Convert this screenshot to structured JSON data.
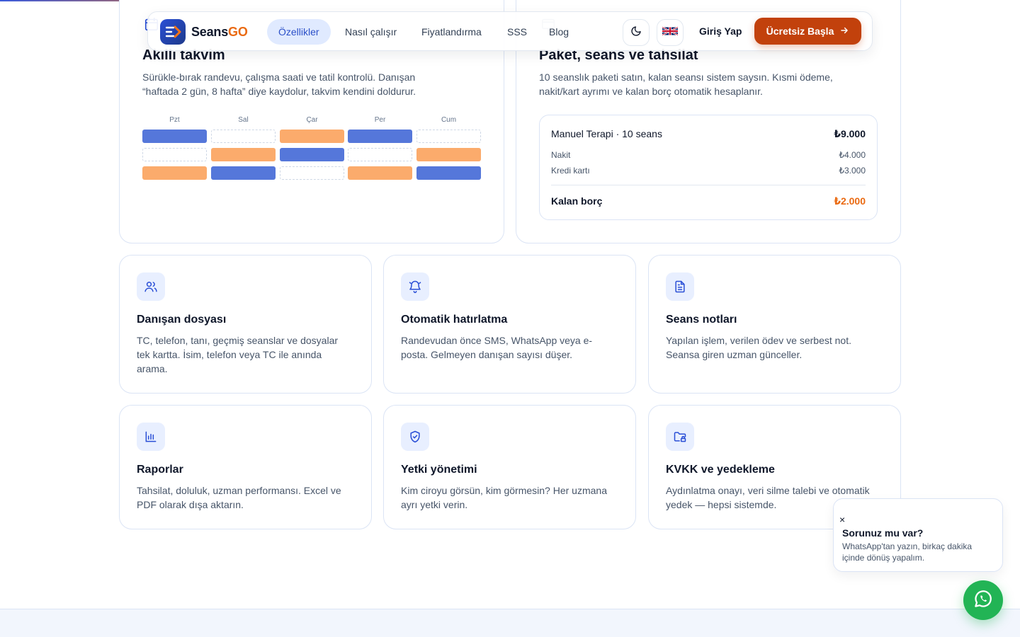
{
  "colors": {
    "brand_blue": "#2a4fd6",
    "brand_orange": "#ea6a12",
    "cta_bg": "#c2410c",
    "slot_blue": "#5577da",
    "slot_orange": "#fbab6c",
    "whatsapp_green": "#22b455",
    "accent_due": "#ea6a12"
  },
  "nav": {
    "logo_text_main": "Seans",
    "logo_text_accent": "GO",
    "links": [
      "Özellikler",
      "Nasıl çalışır",
      "Fiyatlandırma",
      "SSS",
      "Blog"
    ],
    "active_link": "Özellikler",
    "theme_toggle_icon": "moon-icon",
    "language_icon": "uk-flag-icon",
    "login_label": "Giriş Yap",
    "cta_label": "Ücretsiz Başla",
    "cta_icon": "arrow-right-icon"
  },
  "calendar_card": {
    "icon": "calendar-icon",
    "title": "Akıllı takvim",
    "description": "Sürükle-bırak randevu, çalışma saati ve tatil kontrolü. Danışan “haftada 2 gün, 8 hafta” diye kaydolur, takvim kendini doldurur.",
    "days": [
      "Pzt",
      "Sal",
      "Çar",
      "Per",
      "Cum"
    ],
    "slots": [
      [
        "blue",
        "empty",
        "orange",
        "blue",
        "empty"
      ],
      [
        "empty",
        "orange",
        "blue",
        "empty",
        "orange"
      ],
      [
        "orange",
        "blue",
        "empty",
        "orange",
        "blue"
      ]
    ]
  },
  "payment_card": {
    "icon": "package-icon",
    "title": "Paket, seans ve tahsilat",
    "description": "10 seanslık paketi satın, kalan seansı sistem saysın. Kısmi ödeme, nakit/kart ayrımı ve kalan borç otomatik hesaplanır.",
    "package_name": "Manuel Terapi · 10 seans",
    "package_total": "₺9.000",
    "cash_label": "Nakit",
    "cash_value": "₺4.000",
    "card_label": "Kredi kartı",
    "card_value": "₺3.000",
    "due_label": "Kalan borç",
    "due_value": "₺2.000"
  },
  "features": [
    {
      "icon": "users-icon",
      "title": "Danışan dosyası",
      "description": "TC, telefon, tanı, geçmiş seanslar ve dosyalar tek kartta. İsim, telefon veya TC ile anında arama."
    },
    {
      "icon": "bell-ring-icon",
      "title": "Otomatik hatırlatma",
      "description": "Randevudan önce SMS, WhatsApp veya e-posta. Gelmeyen danışan sayısı düşer."
    },
    {
      "icon": "document-icon",
      "title": "Seans notları",
      "description": "Yapılan işlem, verilen ödev ve serbest not. Seansa giren uzman günceller."
    },
    {
      "icon": "bar-chart-icon",
      "title": "Raporlar",
      "description": "Tahsilat, doluluk, uzman performansı. Excel ve PDF olarak dışa aktarın."
    },
    {
      "icon": "shield-check-icon",
      "title": "Yetki yönetimi",
      "description": "Kim ciroyu görsün, kim görmesin? Her uzmana ayrı yetki verin."
    },
    {
      "icon": "folder-lock-icon",
      "title": "KVKK ve yedekleme",
      "description": "Aydınlatma onayı, veri silme talebi ve otomatik yedek — hepsi sistemde."
    }
  ],
  "whatsapp": {
    "close_symbol": "×",
    "title": "Sorunuz mu var?",
    "text": "WhatsApp'tan yazın, birkaç dakika içinde dönüş yapalım.",
    "button_icon": "whatsapp-icon"
  }
}
